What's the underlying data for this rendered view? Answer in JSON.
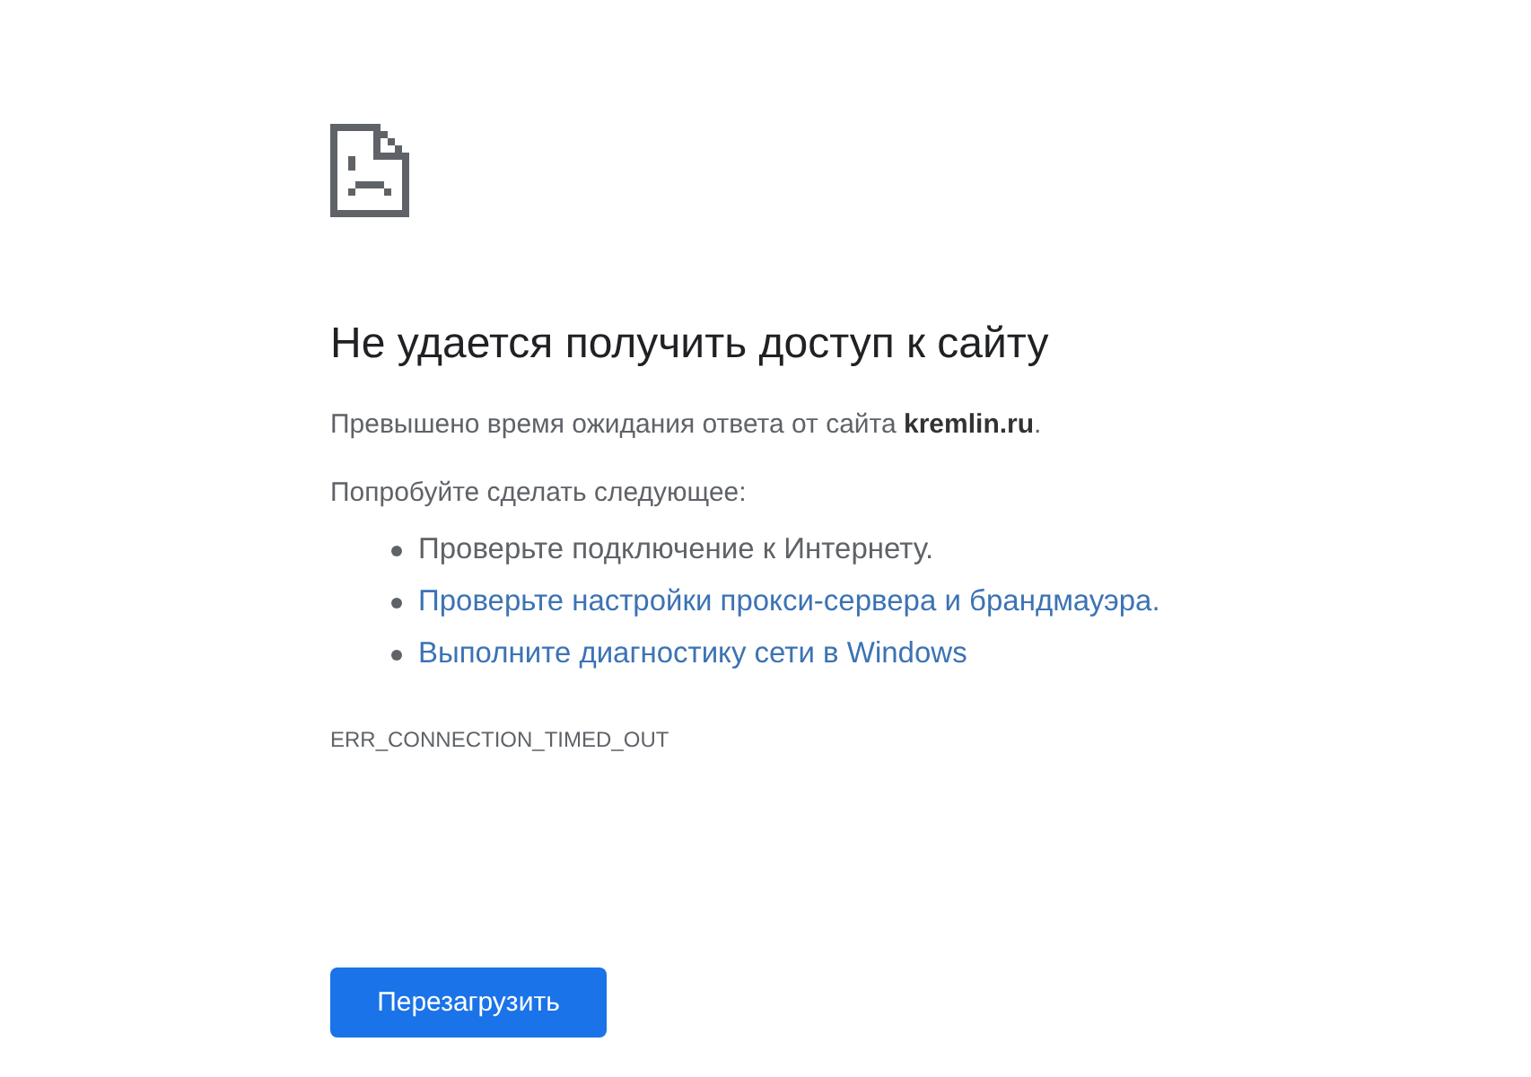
{
  "error_page": {
    "title": "Не удается получить доступ к сайту",
    "message": "Превышено время ожидания ответа от сайта **kremlin.ru**.",
    "suggestions_heading": "Попробуйте сделать следующее:",
    "suggestions": [
      {
        "kind": "text",
        "text": "Проверьте подключение к Интернету."
      },
      {
        "kind": "link",
        "text": "Проверьте настройки прокси-сервера и брандмауэра."
      },
      {
        "kind": "link",
        "text": "Выполните диагностику сети в Windows"
      }
    ],
    "error_code": "ERR_CONNECTION_TIMED_OUT",
    "reload_button": "Перезагрузить"
  }
}
